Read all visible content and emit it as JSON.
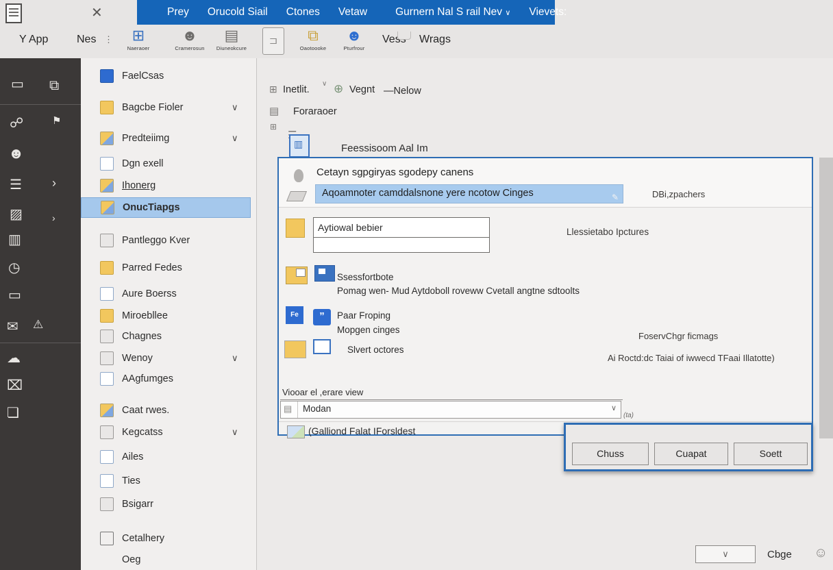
{
  "titlebar": {
    "menu_items": [
      "Prey",
      "Orucold Siail",
      "Ctones",
      "Vetaw"
    ],
    "menu_group2": "Gurnern Nal S rail Nev",
    "viewers_label": "Vievets:"
  },
  "ribbon": {
    "app_label": "Y App",
    "nes_label": "Nes",
    "buttons": [
      {
        "label": "Naeraoer"
      },
      {
        "label": "Cramerosun"
      },
      {
        "label": "Diuneokcure"
      },
      {
        "label": "Oaotoooke"
      },
      {
        "label": "Pturfrour"
      }
    ],
    "views_label": "Vess",
    "wrags_label": "Wrags"
  },
  "sidebar": {
    "items": [
      {
        "label": "FaelCsas"
      },
      {
        "label": "Bagcbe Fioler",
        "chevron": true
      },
      {
        "label": "Predteiimg",
        "chevron": true
      },
      {
        "label": "Dgn exell"
      },
      {
        "label": "Ihonerg"
      },
      {
        "label": "OnucTiapgs",
        "selected": true
      },
      {
        "label": "Pantleggo Kver"
      },
      {
        "label": "Parred Fedes"
      },
      {
        "label": "Aure Boerss"
      },
      {
        "label": "Miroebllee"
      },
      {
        "label": "Chagnes"
      },
      {
        "label": "Wenoy",
        "chevron": true
      },
      {
        "label": "AAgfumges"
      },
      {
        "label": "Caat rwes."
      },
      {
        "label": "Kegcatss",
        "chevron": true
      },
      {
        "label": "Ailes"
      },
      {
        "label": "Ties"
      },
      {
        "label": "Bsigarr"
      },
      {
        "label": "Cetalhery"
      },
      {
        "label": "Oeg"
      }
    ]
  },
  "main": {
    "top": {
      "install_label": "Inetlit.",
      "vegnt_label": "Vegnt",
      "nelow_label": "—Nelow",
      "foraraoer_label": "Foraraoer",
      "freeroom_label": "Feessisoom Aal Im"
    },
    "dialog": {
      "title": "Cetayn sgpgiryas sgodepy canens",
      "selected_option": "Aqoamnoter camddalsnone yere ncotow Cinges",
      "right_note1": "DBi,zpachers",
      "input_value": "Aytiowal bebier",
      "right_note2": "Llessietabo Ipctures",
      "row3_line1": "Ssessfortbote",
      "row3_line2": "Pomag wen- Mud Aytdoboll roveww Cvetall angtne sdtoolts",
      "row4_line1": "Paar Froping",
      "row4_line2": "Mopgen cinges",
      "right_note3": "FoservChgr ficmags",
      "row5_label": "Slvert octores",
      "right_note4": "Ai Roctd:dc Taiai of iwwecd TFaai Illatotte)",
      "view_section_label": "Viooar el ,erare view",
      "view_combo_value": "Modan",
      "side_note": "(ta)",
      "bottom_label": "(Galliond Falat IForsldest"
    },
    "buttons": {
      "close": "Chuss",
      "cancel": "Cuapat",
      "set": "Soett"
    },
    "status": {
      "cbge_label": "Cbge"
    }
  },
  "icons": {
    "close": "✕",
    "caret_down": "∨",
    "dots": "⋮",
    "grid": "⊞",
    "person": "☻",
    "rows": "▤",
    "bracket": "⊐",
    "folders": "⧉",
    "link": "☍",
    "flag": "⚑",
    "list": "☰",
    "chevron_right": "›",
    "image": "▨",
    "table": "▥",
    "clock": "◷",
    "card": "▭",
    "mail": "✉",
    "warning": "⚠",
    "cloud": "☁",
    "trash": "⌧",
    "chat": "❏",
    "globe": "⊕",
    "pencil": "✎",
    "quote": "”",
    "face": "☺"
  },
  "colors": {
    "accent_blue": "#1565b8",
    "dialog_border": "#2e6db4",
    "selection": "#a5c8ec",
    "rail_bg": "#3b3837"
  }
}
